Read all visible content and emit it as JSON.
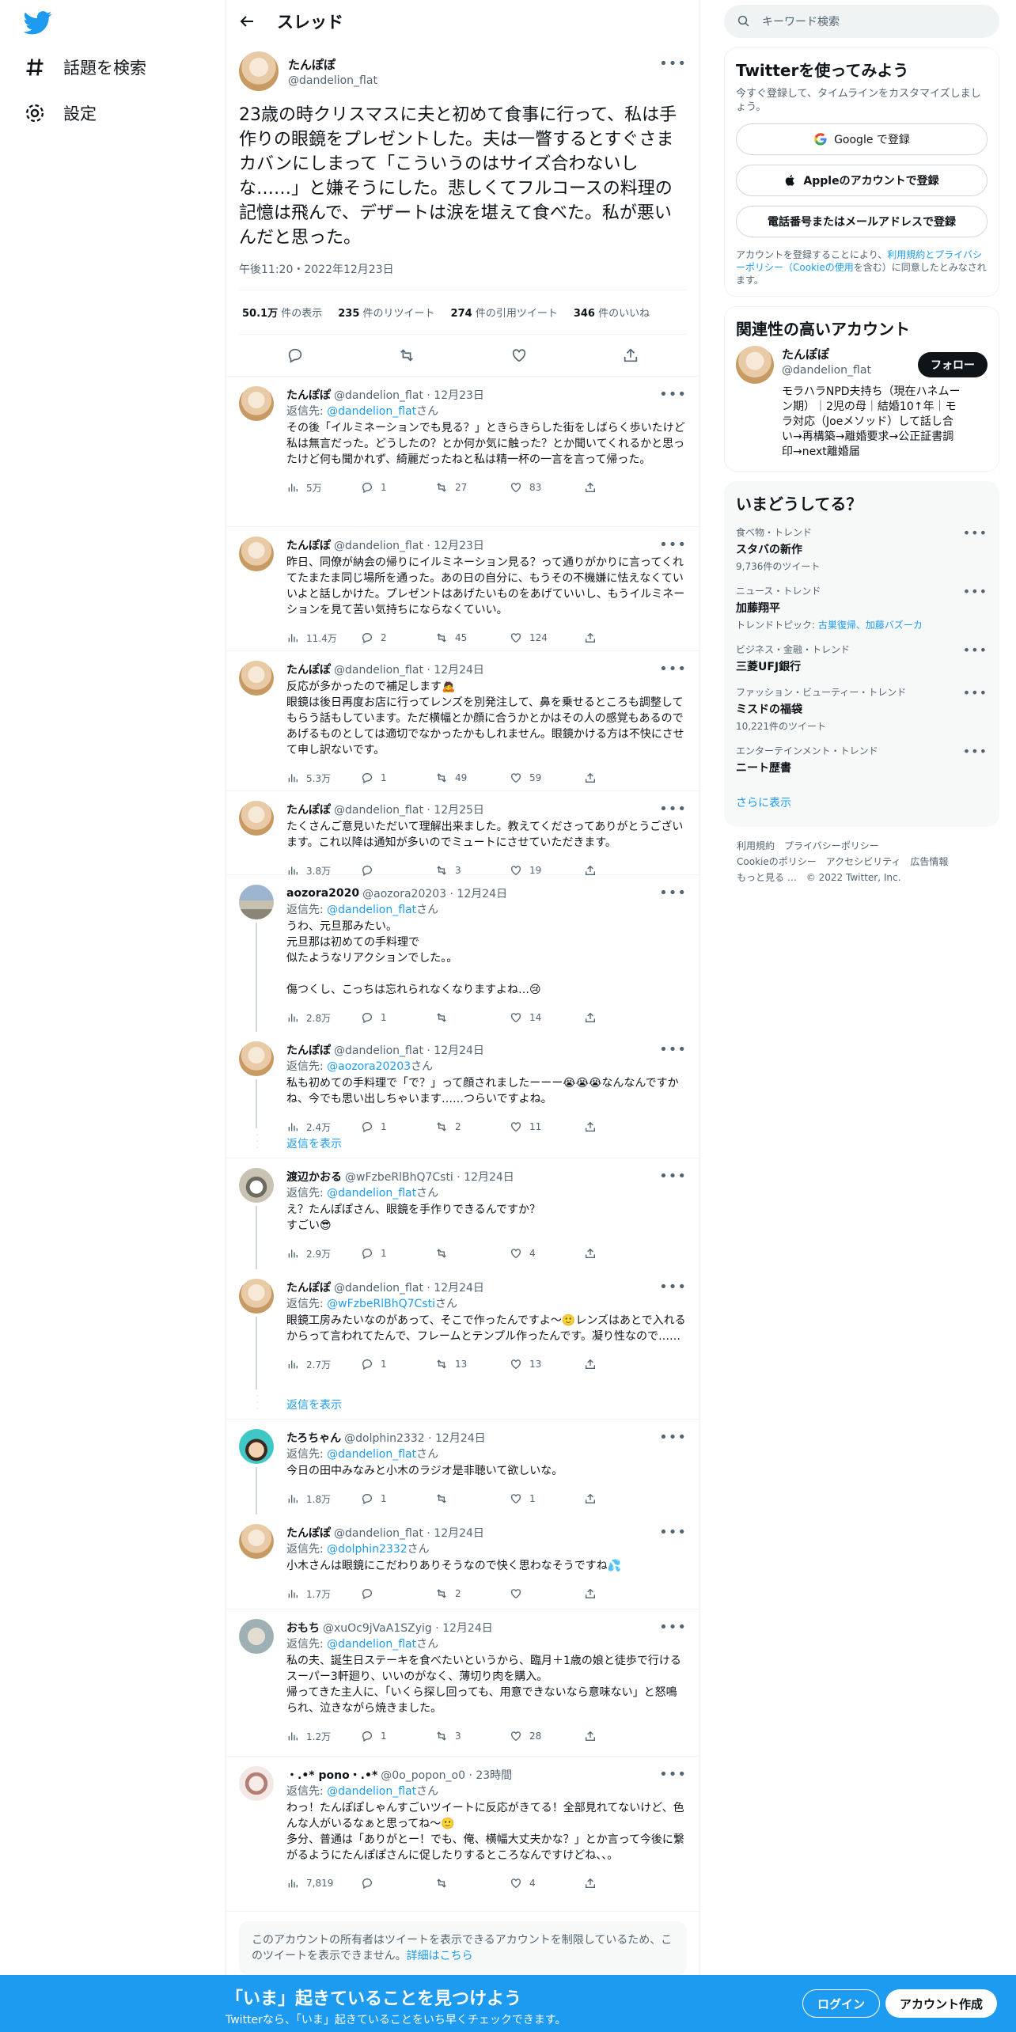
{
  "colors": {
    "accent": "#1d9bf0",
    "text": "#0f1419",
    "muted": "#536471"
  },
  "nav": {
    "explore": "話題を検索",
    "settings": "設定"
  },
  "header": {
    "title": "スレッド"
  },
  "focus": {
    "name": "たんぽぽ",
    "handle": "@dandelion_flat",
    "text": "23歳の時クリスマスに夫と初めて食事に行って、私は手作りの眼鏡をプレゼントした。夫は一瞥するとすぐさまカバンにしまって「こういうのはサイズ合わないしな……」と嫌そうにした。悲しくてフルコースの料理の記憶は飛んで、デザートは涙を堪えて食べた。私が悪いんだと思った。",
    "date": "午後11:20・2022年12月23日",
    "stats": [
      {
        "num": "50.1万",
        "label": "件の表示"
      },
      {
        "num": "235",
        "label": "件のリツイート"
      },
      {
        "num": "274",
        "label": "件の引用ツイート"
      },
      {
        "num": "346",
        "label": "件のいいね"
      }
    ]
  },
  "reply_to_label": "返信先: ",
  "reply_to_suffix": "さん",
  "replies": [
    {
      "name": "たんぽぽ",
      "meta": "@dandelion_flat · 12月23日",
      "to": "@dandelion_flat",
      "text": "その後「イルミネーションでも見る？」ときらきらした街をしばらく歩いたけど私は無言だった。どうしたの？とか何か気に触った？とか聞いてくれるかと思ったけど何も聞かれず、綺麗だったねと私は精一杯の一言を言って帰った。",
      "views": "5万",
      "replies": "1",
      "rts": "27",
      "likes": "83"
    },
    {
      "name": "たんぽぽ",
      "meta": "@dandelion_flat · 12月23日",
      "to": "",
      "text": "昨日、同僚が納会の帰りにイルミネーション見る？って通りがかりに言ってくれてたまたま同じ場所を通った。あの日の自分に、もうその不機嫌に怯えなくていいよと話しかけた。プレゼントはあげたいものをあげていいし、もうイルミネーションを見て苦い気持ちにならなくていい。",
      "views": "11.4万",
      "replies": "2",
      "rts": "45",
      "likes": "124"
    },
    {
      "name": "たんぽぽ",
      "meta": "@dandelion_flat · 12月24日",
      "to": "",
      "text": "反応が多かったので補足します🙇\n眼鏡は後日再度お店に行ってレンズを別発注して、鼻を乗せるところも調整してもらう話もしています。ただ横幅とか顔に合うかとかはその人の感覚もあるのであげるものとしては適切でなかったかもしれません。眼鏡かける方は不快にさせて申し訳ないです。",
      "views": "5.3万",
      "replies": "1",
      "rts": "49",
      "likes": "59"
    },
    {
      "name": "たんぽぽ",
      "meta": "@dandelion_flat · 12月25日",
      "to": "",
      "text": "たくさんご意見いただいて理解出来ました。教えてくださってありがとうございます。これ以降は通知が多いのでミュートにさせていただきます。",
      "views": "3.8万",
      "replies": "",
      "rts": "3",
      "likes": "19"
    },
    {
      "name": "aozora2020",
      "meta": "@aozora20203 · 12月24日",
      "to": "@dandelion_flat",
      "text": "うわ、元旦那みたい。\n元旦那は初めての手料理で\n似たようなリアクションでした。。\n\n傷つくし、こっちは忘れられなくなりますよね…😢",
      "views": "2.8万",
      "replies": "1",
      "rts": "",
      "likes": "14"
    },
    {
      "name": "たんぽぽ",
      "meta": "@dandelion_flat · 12月24日",
      "to": "@aozora20203",
      "text": "私も初めての手料理で「で？」って顔されましたーーー😭😭😭なんなんですかね、今でも思い出しちゃいます……つらいですよね。",
      "views": "2.4万",
      "replies": "1",
      "rts": "2",
      "likes": "11"
    },
    {
      "name": "渡辺かおる",
      "meta": "@wFzbeRlBhQ7Csti · 12月24日",
      "to": "@dandelion_flat",
      "text": "え？たんぽぽさん、眼鏡を手作りできるんですか？\nすごい😎",
      "views": "2.9万",
      "replies": "1",
      "rts": "",
      "likes": "4"
    },
    {
      "name": "たんぽぽ",
      "meta": "@dandelion_flat · 12月24日",
      "to": "@wFzbeRlBhQ7Csti",
      "text": "眼鏡工房みたいなのがあって、そこで作ったんですよ〜🙂レンズはあとで入れるからって言われてたんで、フレームとテンプル作ったんです。凝り性なので……",
      "views": "2.7万",
      "replies": "1",
      "rts": "13",
      "likes": "13"
    },
    {
      "name": "たろちゃん",
      "meta": "@dolphin2332 · 12月24日",
      "to": "@dandelion_flat",
      "text": "今日の田中みなみと小木のラジオ是非聴いて欲しいな。",
      "views": "1.8万",
      "replies": "1",
      "rts": "",
      "likes": "1"
    },
    {
      "name": "たんぽぽ",
      "meta": "@dandelion_flat · 12月24日",
      "to": "@dolphin2332",
      "text": "小木さんは眼鏡にこだわりありそうなので快く思わなそうですね💦",
      "views": "1.7万",
      "replies": "",
      "rts": "2",
      "likes": ""
    },
    {
      "name": "おもち",
      "meta": "@xuOc9jVaA1SZyig · 12月24日",
      "to": "@dandelion_flat",
      "text": "私の夫、誕生日ステーキを食べたいというから、臨月＋1歳の娘と徒歩で行けるスーパー3軒廻り、いいのがなく、薄切り肉を購入。\n帰ってきた主人に、「いくら探し回っても、用意できないなら意味ない」と怒鳴られ、泣きながら焼きました。",
      "views": "1.2万",
      "replies": "1",
      "rts": "3",
      "likes": "28"
    },
    {
      "name": "・.•* pono・.•*",
      "meta": "@0o_popon_o0 · 23時間",
      "to": "@dandelion_flat",
      "text": "わっ！たんぽぽしゃんすごいツイートに反応がきてる！全部見れてないけど、色んな人がいるなぁと思ってね〜🙂\n多分、普通は「ありがとー！でも、俺、横幅大丈夫かな？」とか言って今後に繋がるようにたんぽぽさんに促したりするところなんですけどね、、。",
      "views": "7,819",
      "replies": "",
      "rts": "",
      "likes": "4"
    }
  ],
  "show_replies": "返信を表示",
  "restricted": {
    "text": "このアカウントの所有者はツイートを表示できるアカウントを制限しているため、このツイートを表示できません。",
    "link": "詳細はこちら"
  },
  "sidebar": {
    "search_placeholder": "キーワード検索",
    "signup": {
      "title": "Twitterを使ってみよう",
      "sub": "今すぐ登録して、タイムラインをカスタマイズしましょう。",
      "google": "Google で登録",
      "apple": "Appleのアカウントで登録",
      "phone": "電話番号またはメールアドレスで登録",
      "legal_a": "アカウントを登録することにより、",
      "legal_link": "利用規約とプライバシーポリシー（Cookieの使用",
      "legal_b": "を含む）に同意したとみなされます。"
    },
    "relevant": {
      "title": "関連性の高いアカウント",
      "name": "たんぽぽ",
      "handle": "@dandelion_flat",
      "bio": "モラハラNPD夫持ち（現在ハネムーン期）｜2児の母｜結婚10↑年｜モラ対応（Joeメソッド）して話し合い→再構築→離婚要求→公正証書調印→next離婚届",
      "follow": "フォロー"
    },
    "trends": {
      "title": "いまどうしてる？",
      "items": [
        {
          "ctx": "食べ物・トレンド",
          "name": "スタバの新作",
          "count": "9,736件のツイート",
          "topic": ""
        },
        {
          "ctx": "ニュース・トレンド",
          "name": "加藤翔平",
          "count": "トレンドトピック: ",
          "topic": "古巣復帰、加藤バズーカ"
        },
        {
          "ctx": "ビジネス・金融・トレンド",
          "name": "三菱UFJ銀行",
          "count": "",
          "topic": ""
        },
        {
          "ctx": "ファッション・ビューティー・トレンド",
          "name": "ミスドの福袋",
          "count": "10,221件のツイート",
          "topic": ""
        },
        {
          "ctx": "エンターテインメント・トレンド",
          "name": "ニート歴書",
          "count": "",
          "topic": ""
        }
      ],
      "show_more": "さらに表示"
    },
    "footer": {
      "row1": [
        "利用規約",
        "プライバシーポリシー"
      ],
      "row2": [
        "Cookieのポリシー",
        "アクセシビリティ",
        "広告情報"
      ],
      "row3": [
        "もっと見る …",
        "© 2022 Twitter, Inc."
      ]
    }
  },
  "bottom": {
    "title": "「いま」起きていることを見つけよう",
    "sub": "Twitterなら、「いま」起きていることをいち早くチェックできます。",
    "login": "ログイン",
    "signup": "アカウント作成"
  }
}
